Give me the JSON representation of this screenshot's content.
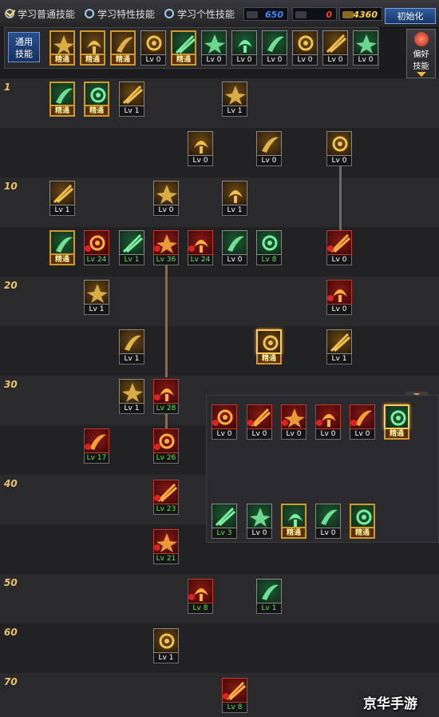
{
  "header": {
    "options": [
      {
        "label": "学习普通技能",
        "checked": true
      },
      {
        "label": "学习特性技能",
        "checked": false
      },
      {
        "label": "学习个性技能",
        "checked": false
      }
    ],
    "resources": [
      {
        "name": "sp",
        "value": "650",
        "color": "#3a8cff"
      },
      {
        "name": "tp",
        "value": "0",
        "color": "#ff3a2a"
      },
      {
        "name": "gold",
        "value": "4360",
        "color": "#ffd23a"
      }
    ],
    "init_button": "初始化"
  },
  "common": {
    "label_line1": "通用",
    "label_line2": "技能",
    "skills": [
      {
        "badge": "精通",
        "icon": "scroll-glyph-icon",
        "tone": "gold"
      },
      {
        "badge": "精通",
        "icon": "runner-icon",
        "tone": "gold"
      },
      {
        "badge": "精通",
        "icon": "sprint-icon",
        "tone": "gold"
      },
      {
        "badge": "Lv 0",
        "icon": "wings-icon",
        "tone": "gold"
      },
      {
        "badge": "精通",
        "icon": "target-icon",
        "tone": "green"
      },
      {
        "badge": "Lv 0",
        "icon": "crosshair-icon",
        "tone": "green"
      },
      {
        "badge": "Lv 0",
        "icon": "leap-icon",
        "tone": "green"
      },
      {
        "badge": "Lv 0",
        "icon": "tree-icon",
        "tone": "green"
      },
      {
        "badge": "Lv 0",
        "icon": "eye-icon",
        "tone": "gold"
      },
      {
        "badge": "Lv 0",
        "icon": "flex-icon",
        "tone": "gold"
      },
      {
        "badge": "Lv 0",
        "icon": "rune-icon",
        "tone": "green"
      }
    ],
    "side_button": {
      "line1": "偏好",
      "line2": "技能"
    }
  },
  "tree": {
    "levels": [
      "1",
      "10",
      "20",
      "30",
      "40",
      "50",
      "60",
      "70"
    ],
    "skills": [
      {
        "id": "s1",
        "badge": "精通",
        "tone": "green"
      },
      {
        "id": "s2",
        "badge": "精通",
        "tone": "green"
      },
      {
        "id": "s3",
        "badge": "Lv 1",
        "tone": "gold"
      },
      {
        "id": "s4",
        "badge": "Lv 1",
        "tone": "gold"
      },
      {
        "id": "s5",
        "badge": "Lv 0",
        "tone": "gold"
      },
      {
        "id": "s6",
        "badge": "Lv 0",
        "tone": "gold"
      },
      {
        "id": "s7",
        "badge": "Lv 0",
        "tone": "gold"
      },
      {
        "id": "s8",
        "badge": "Lv 1",
        "tone": "gold"
      },
      {
        "id": "s9",
        "badge": "Lv 0",
        "tone": "gold"
      },
      {
        "id": "s10",
        "badge": "Lv 1",
        "tone": "gold"
      },
      {
        "id": "s11",
        "badge": "精通",
        "tone": "green"
      },
      {
        "id": "s12",
        "badge": "Lv 24",
        "tone": "red"
      },
      {
        "id": "s13",
        "badge": "Lv 1",
        "tone": "green"
      },
      {
        "id": "s14",
        "badge": "Lv 36",
        "tone": "red"
      },
      {
        "id": "s15",
        "badge": "Lv 24",
        "tone": "red"
      },
      {
        "id": "s16",
        "badge": "Lv 0",
        "tone": "green"
      },
      {
        "id": "s17",
        "badge": "Lv 8",
        "tone": "green"
      },
      {
        "id": "s18",
        "badge": "Lv 0",
        "tone": "red"
      },
      {
        "id": "s19",
        "badge": "Lv 1",
        "tone": "gold"
      },
      {
        "id": "s20",
        "badge": "Lv 0",
        "tone": "red"
      },
      {
        "id": "s21",
        "badge": "Lv 1",
        "tone": "gold"
      },
      {
        "id": "s22",
        "badge": "精通",
        "tone": "gold"
      },
      {
        "id": "s23",
        "badge": "Lv 1",
        "tone": "gold"
      },
      {
        "id": "s24",
        "badge": "Lv 1",
        "tone": "gold"
      },
      {
        "id": "s25",
        "badge": "Lv 28",
        "tone": "red"
      },
      {
        "id": "s26",
        "badge": "Lv 17",
        "tone": "red"
      },
      {
        "id": "s27",
        "badge": "Lv 26",
        "tone": "red"
      },
      {
        "id": "s28",
        "badge": "Lv 23",
        "tone": "red"
      },
      {
        "id": "s29",
        "badge": "Lv 21",
        "tone": "red"
      },
      {
        "id": "s30",
        "badge": "Lv 8",
        "tone": "red"
      },
      {
        "id": "s31",
        "badge": "Lv 1",
        "tone": "green"
      },
      {
        "id": "s32",
        "badge": "Lv 1",
        "tone": "gold"
      },
      {
        "id": "s33",
        "badge": "Lv 8",
        "tone": "red"
      }
    ]
  },
  "panel": {
    "row1": [
      {
        "badge": "Lv 0",
        "tone": "red"
      },
      {
        "badge": "Lv 0",
        "tone": "red"
      },
      {
        "badge": "Lv 0",
        "tone": "red"
      },
      {
        "badge": "Lv 0",
        "tone": "red"
      },
      {
        "badge": "Lv 0",
        "tone": "red"
      },
      {
        "badge": "精通",
        "tone": "green"
      }
    ],
    "row2": [
      {
        "badge": "Lv 3",
        "tone": "green"
      },
      {
        "badge": "Lv 0",
        "tone": "green"
      },
      {
        "badge": "精通",
        "tone": "green"
      },
      {
        "badge": "Lv 0",
        "tone": "green"
      },
      {
        "badge": "精通",
        "tone": "green"
      }
    ]
  },
  "watermark": "京华手游"
}
